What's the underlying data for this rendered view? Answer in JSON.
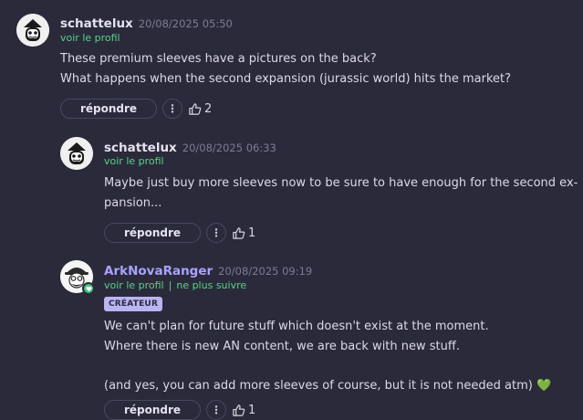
{
  "comments": [
    {
      "author": "schattelux",
      "date": "20/08/2025 05:50",
      "profile_link": "voir le profil",
      "text": [
        "These premium sleeves have a pictures on the back?",
        "What happens when the second expansion (jurassic world) hits the market?"
      ],
      "reply_label": "répondre",
      "more_icon": "⋮",
      "likes": "2"
    },
    {
      "author": "schattelux",
      "date": "20/08/2025 06:33",
      "profile_link": "voir le profil",
      "text": [
        "Maybe just buy more sleeves now to be sure to have enough for the second ex-",
        "pansion..."
      ],
      "reply_label": "répondre",
      "more_icon": "⋮",
      "likes": "1"
    },
    {
      "author": "ArkNovaRanger",
      "date": "20/08/2025 09:19",
      "profile_link": "voir le profil",
      "separator": "|",
      "unfollow_link": "ne plus suivre",
      "badge": "CRÉATEUR",
      "text": [
        "We can't plan for future stuff which doesn't exist at the moment.",
        "Where there is new AN content, we are back with new stuff.",
        "",
        "(and yes, you can add more sleeves of course, but it is not needed atm)"
      ],
      "emoji": "💚",
      "reply_label": "répondre",
      "more_icon": "⋮",
      "likes": "1"
    }
  ],
  "colors": {
    "background": "#2b2a3a",
    "link": "#57d38a",
    "creator_name": "#a9a3ff",
    "badge_bg": "#b9b4f5",
    "heart": "#3fc47e"
  }
}
